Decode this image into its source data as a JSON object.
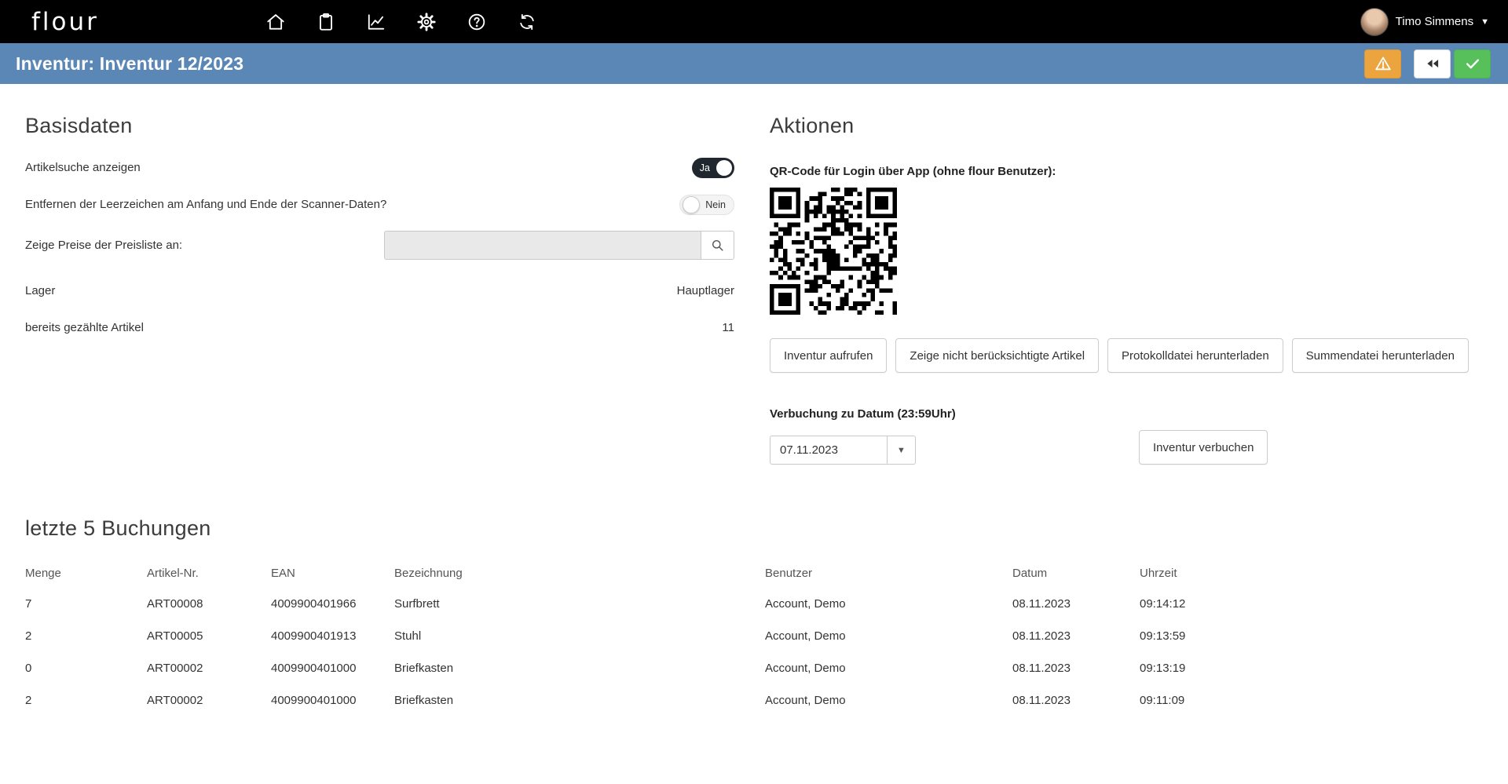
{
  "topbar": {
    "logo": "flour",
    "user": "Timo Simmens"
  },
  "header": {
    "title": "Inventur: Inventur 12/2023"
  },
  "basisdaten": {
    "title": "Basisdaten",
    "artikelsuche_label": "Artikelsuche anzeigen",
    "artikelsuche_value": "Ja",
    "leerzeichen_label": "Entfernen der Leerzeichen am Anfang und Ende der Scanner-Daten?",
    "leerzeichen_value": "Nein",
    "preisliste_label": "Zeige Preise der Preisliste an:",
    "preisliste_input": "",
    "lager_label": "Lager",
    "lager_value": "Hauptlager",
    "gezaehlt_label": "bereits gezählte Artikel",
    "gezaehlt_value": "11"
  },
  "aktionen": {
    "title": "Aktionen",
    "qr_label": "QR-Code für Login über App (ohne flour Benutzer):",
    "buttons": [
      "Inventur aufrufen",
      "Zeige nicht berücksichtigte Artikel",
      "Protokolldatei herunterladen",
      "Summendatei herunterladen"
    ],
    "verbuchung_label": "Verbuchung zu Datum (23:59Uhr)",
    "datum_value": "07.11.2023",
    "verbuchen_label": "Inventur verbuchen"
  },
  "buchungen": {
    "title": "letzte 5 Buchungen",
    "columns": [
      "Menge",
      "Artikel-Nr.",
      "EAN",
      "Bezeichnung",
      "Benutzer",
      "Datum",
      "Uhrzeit"
    ],
    "rows": [
      [
        "7",
        "ART00008",
        "4009900401966",
        "Surfbrett",
        "Account, Demo",
        "08.11.2023",
        "09:14:12"
      ],
      [
        "2",
        "ART00005",
        "4009900401913",
        "Stuhl",
        "Account, Demo",
        "08.11.2023",
        "09:13:59"
      ],
      [
        "0",
        "ART00002",
        "4009900401000",
        "Briefkasten",
        "Account, Demo",
        "08.11.2023",
        "09:13:19"
      ],
      [
        "2",
        "ART00002",
        "4009900401000",
        "Briefkasten",
        "Account, Demo",
        "08.11.2023",
        "09:11:09"
      ]
    ]
  },
  "colors": {
    "header_blue": "#5b87b6",
    "warning_orange": "#eca43e",
    "success_green": "#57c05a",
    "topbar_black": "#000000"
  }
}
